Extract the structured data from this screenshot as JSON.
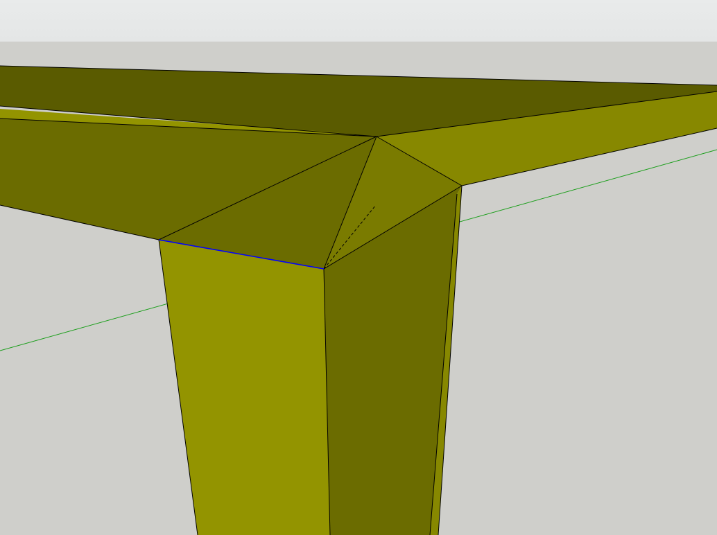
{
  "viewport": {
    "sky_color": "#e4e6e6",
    "sky_gradient_top": "#e9ebeb",
    "ground_color": "#cfcfcb"
  },
  "model": {
    "material_colors": {
      "light": "#939400",
      "medium": "#878800",
      "dark": "#6b6c00",
      "darker": "#5a5b00",
      "edge": "#000000",
      "selected_edge": "#0000ff"
    }
  },
  "axes": {
    "green_axis_color": "#1a9e1a"
  },
  "icons": [
    "green-axis-line",
    "selected-blue-edge",
    "hidden-dashed-edge"
  ]
}
